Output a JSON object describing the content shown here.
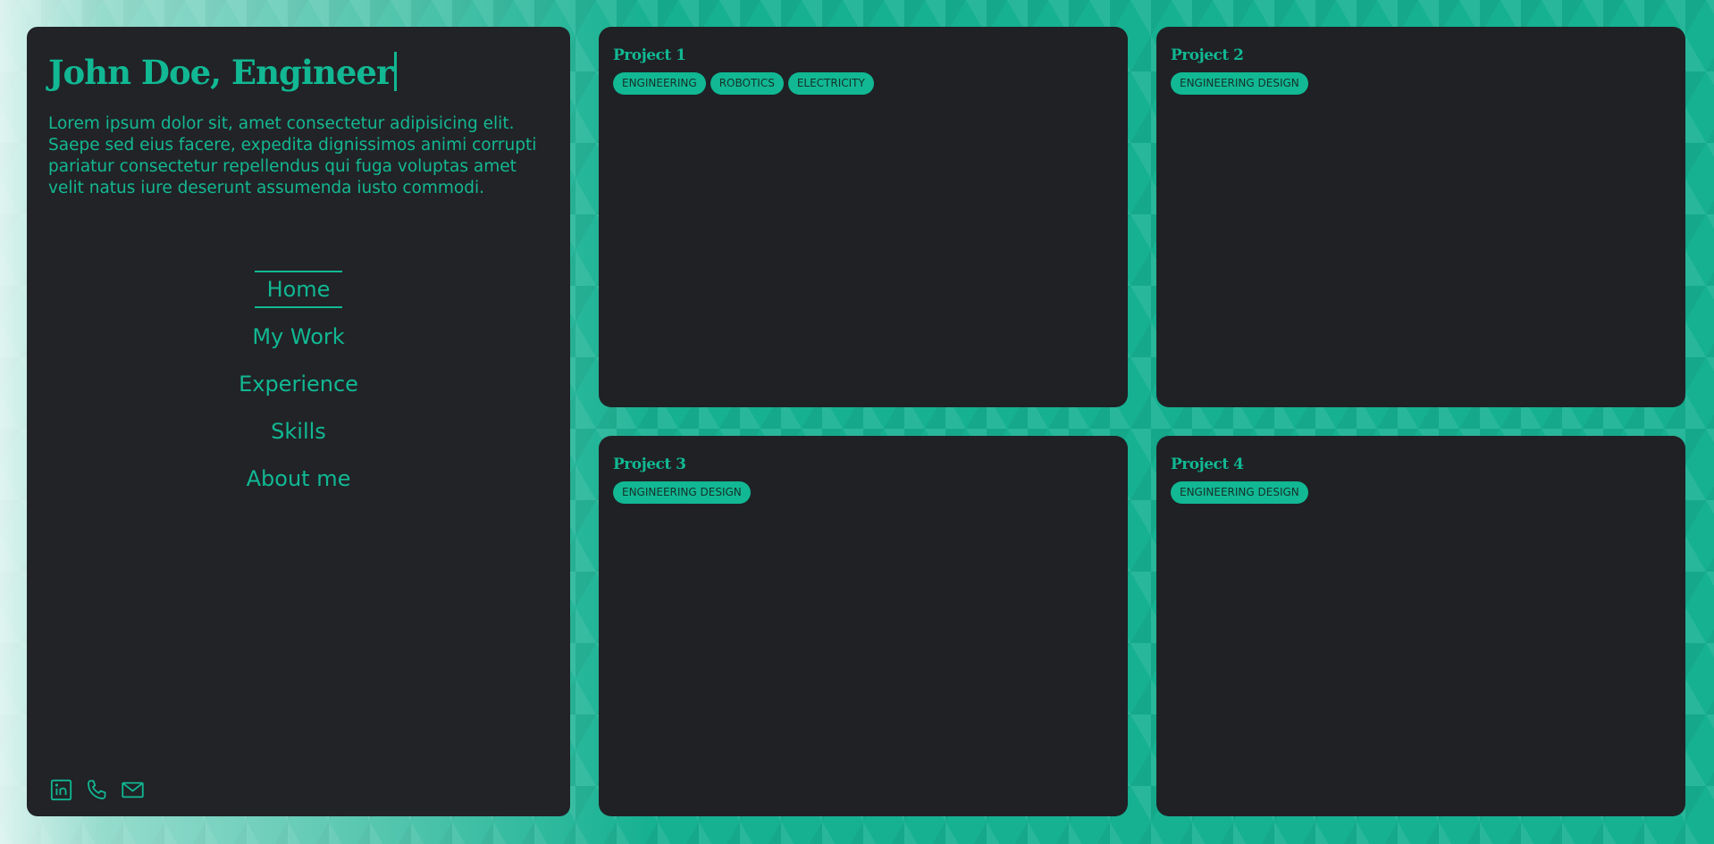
{
  "sidebar": {
    "title": "John Doe, Engineer",
    "intro": "Lorem ipsum dolor sit, amet consectetur adipisicing elit. Saepe sed eius facere, expedita dignissimos animi corrupti pariatur consectetur repellendus qui fuga voluptas amet velit natus iure deserunt assumenda iusto commodi.",
    "nav": [
      {
        "label": "Home",
        "active": true
      },
      {
        "label": "My Work",
        "active": false
      },
      {
        "label": "Experience",
        "active": false
      },
      {
        "label": "Skills",
        "active": false
      },
      {
        "label": "About me",
        "active": false
      }
    ],
    "socials": [
      {
        "icon": "linkedin-icon"
      },
      {
        "icon": "phone-icon"
      },
      {
        "icon": "mail-icon"
      }
    ]
  },
  "projects": [
    {
      "title": "Project 1",
      "tags": [
        "ENGINEERING",
        "ROBOTICS",
        "ELECTRICITY"
      ]
    },
    {
      "title": "Project 2",
      "tags": [
        "ENGINEERING DESIGN"
      ]
    },
    {
      "title": "Project 3",
      "tags": [
        "ENGINEERING DESIGN"
      ]
    },
    {
      "title": "Project 4",
      "tags": [
        "ENGINEERING DESIGN"
      ]
    }
  ],
  "colors": {
    "accent": "#11b893",
    "panel": "#212327",
    "card": "#1f2125",
    "background": "#16b191"
  }
}
